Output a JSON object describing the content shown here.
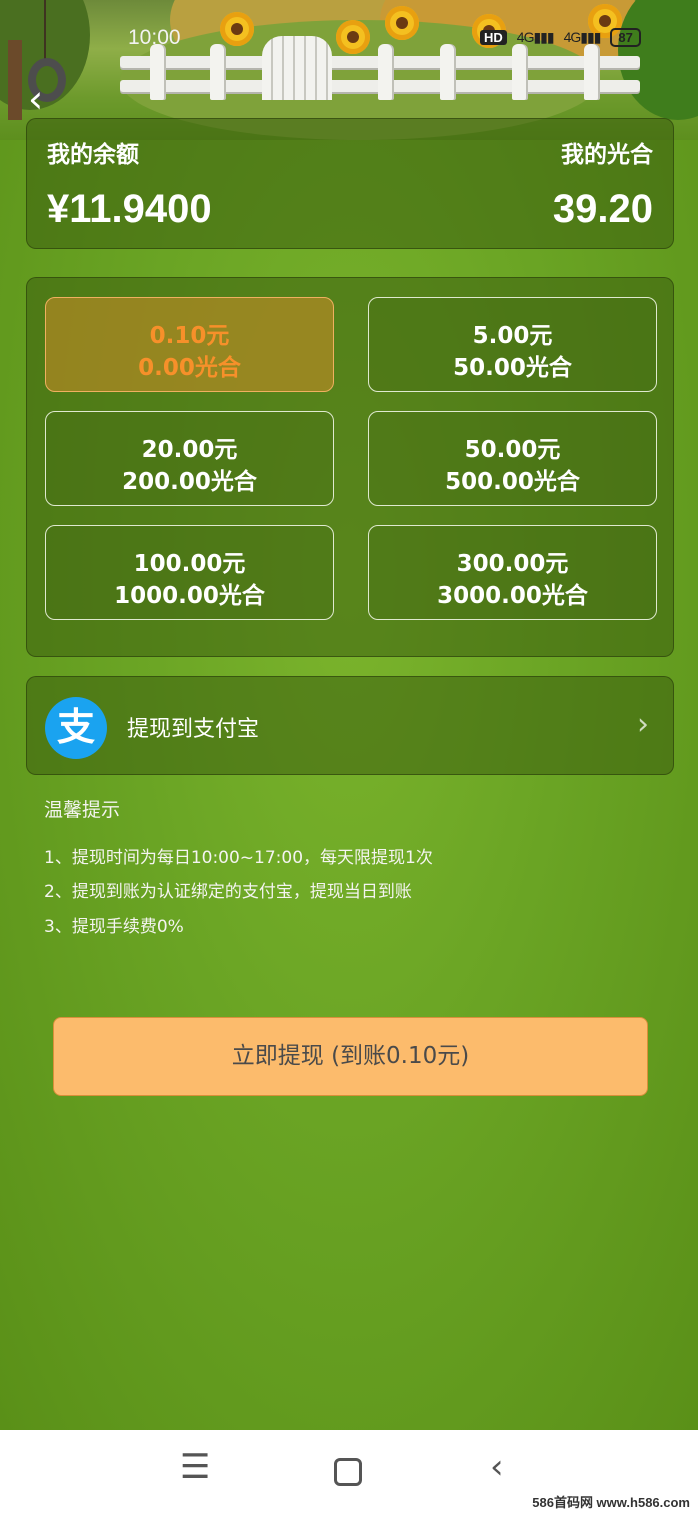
{
  "status_bar": {
    "time": "10:00",
    "hd": "HD",
    "signal1": "4G",
    "signal2": "4G",
    "battery": "87"
  },
  "header": {
    "back_icon": "chevron-left-icon"
  },
  "balance": {
    "balance_label": "我的余额",
    "balance_value": "¥11.9400",
    "points_label": "我的光合",
    "points_value": "39.20"
  },
  "options": [
    {
      "amount": "0.10元",
      "points": "0.00光合",
      "selected": true
    },
    {
      "amount": "5.00元",
      "points": "50.00光合",
      "selected": false
    },
    {
      "amount": "20.00元",
      "points": "200.00光合",
      "selected": false
    },
    {
      "amount": "50.00元",
      "points": "500.00光合",
      "selected": false
    },
    {
      "amount": "100.00元",
      "points": "1000.00光合",
      "selected": false
    },
    {
      "amount": "300.00元",
      "points": "3000.00光合",
      "selected": false
    }
  ],
  "payment": {
    "icon": "alipay-icon",
    "icon_glyph": "支",
    "label": "提现到支付宝",
    "chevron": "›"
  },
  "tips": {
    "title": "温馨提示",
    "items": [
      "1、提现时间为每日10:00~17:00，每天限提现1次",
      "2、提现到账为认证绑定的支付宝，提现当日到账",
      "3、提现手续费0%"
    ]
  },
  "submit": {
    "label": "立即提现 (到账0.10元)"
  },
  "navbar": {
    "menu_glyph": "☰",
    "back_glyph": "‹",
    "watermark": "586首码网 www.h586.com"
  },
  "colors": {
    "selected_accent": "#f7902a",
    "button_bg": "#fcbb6c",
    "alipay_blue": "#1aa3f0"
  }
}
